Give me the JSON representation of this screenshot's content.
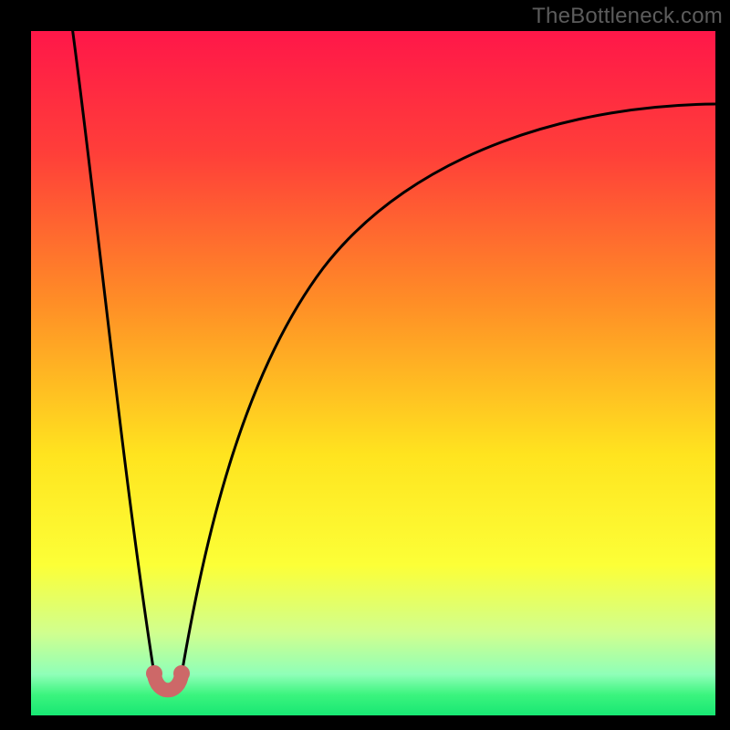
{
  "watermark": "TheBottleneck.com",
  "chart_data": {
    "type": "line",
    "title": "",
    "xlabel": "",
    "ylabel": "",
    "xlim": [
      0,
      100
    ],
    "ylim": [
      0,
      100
    ],
    "grid": false,
    "legend": false,
    "background_gradient": [
      {
        "pct": 0,
        "color": "#ff1749"
      },
      {
        "pct": 18,
        "color": "#ff3f39"
      },
      {
        "pct": 40,
        "color": "#ff8f26"
      },
      {
        "pct": 62,
        "color": "#ffe41f"
      },
      {
        "pct": 78,
        "color": "#fcff37"
      },
      {
        "pct": 88,
        "color": "#d0ff8f"
      },
      {
        "pct": 94,
        "color": "#8fffb8"
      },
      {
        "pct": 97,
        "color": "#3bf47e"
      },
      {
        "pct": 100,
        "color": "#18e773"
      }
    ],
    "series": [
      {
        "name": "bottleneck-curve-left",
        "x": [
          6,
          8,
          10,
          12,
          14,
          16,
          18
        ],
        "y": [
          100,
          85,
          68,
          52,
          35,
          18,
          6
        ]
      },
      {
        "name": "bottleneck-curve-right",
        "x": [
          22,
          24,
          27,
          30,
          34,
          40,
          48,
          58,
          70,
          84,
          100
        ],
        "y": [
          6,
          18,
          32,
          42,
          52,
          62,
          70,
          77,
          82,
          86,
          89
        ]
      }
    ],
    "markers": {
      "name": "optimal-zone",
      "color": "#cd6868",
      "points": [
        {
          "x": 18,
          "y": 6
        },
        {
          "x": 19,
          "y": 3
        },
        {
          "x": 21,
          "y": 3
        },
        {
          "x": 22,
          "y": 6
        }
      ]
    }
  }
}
